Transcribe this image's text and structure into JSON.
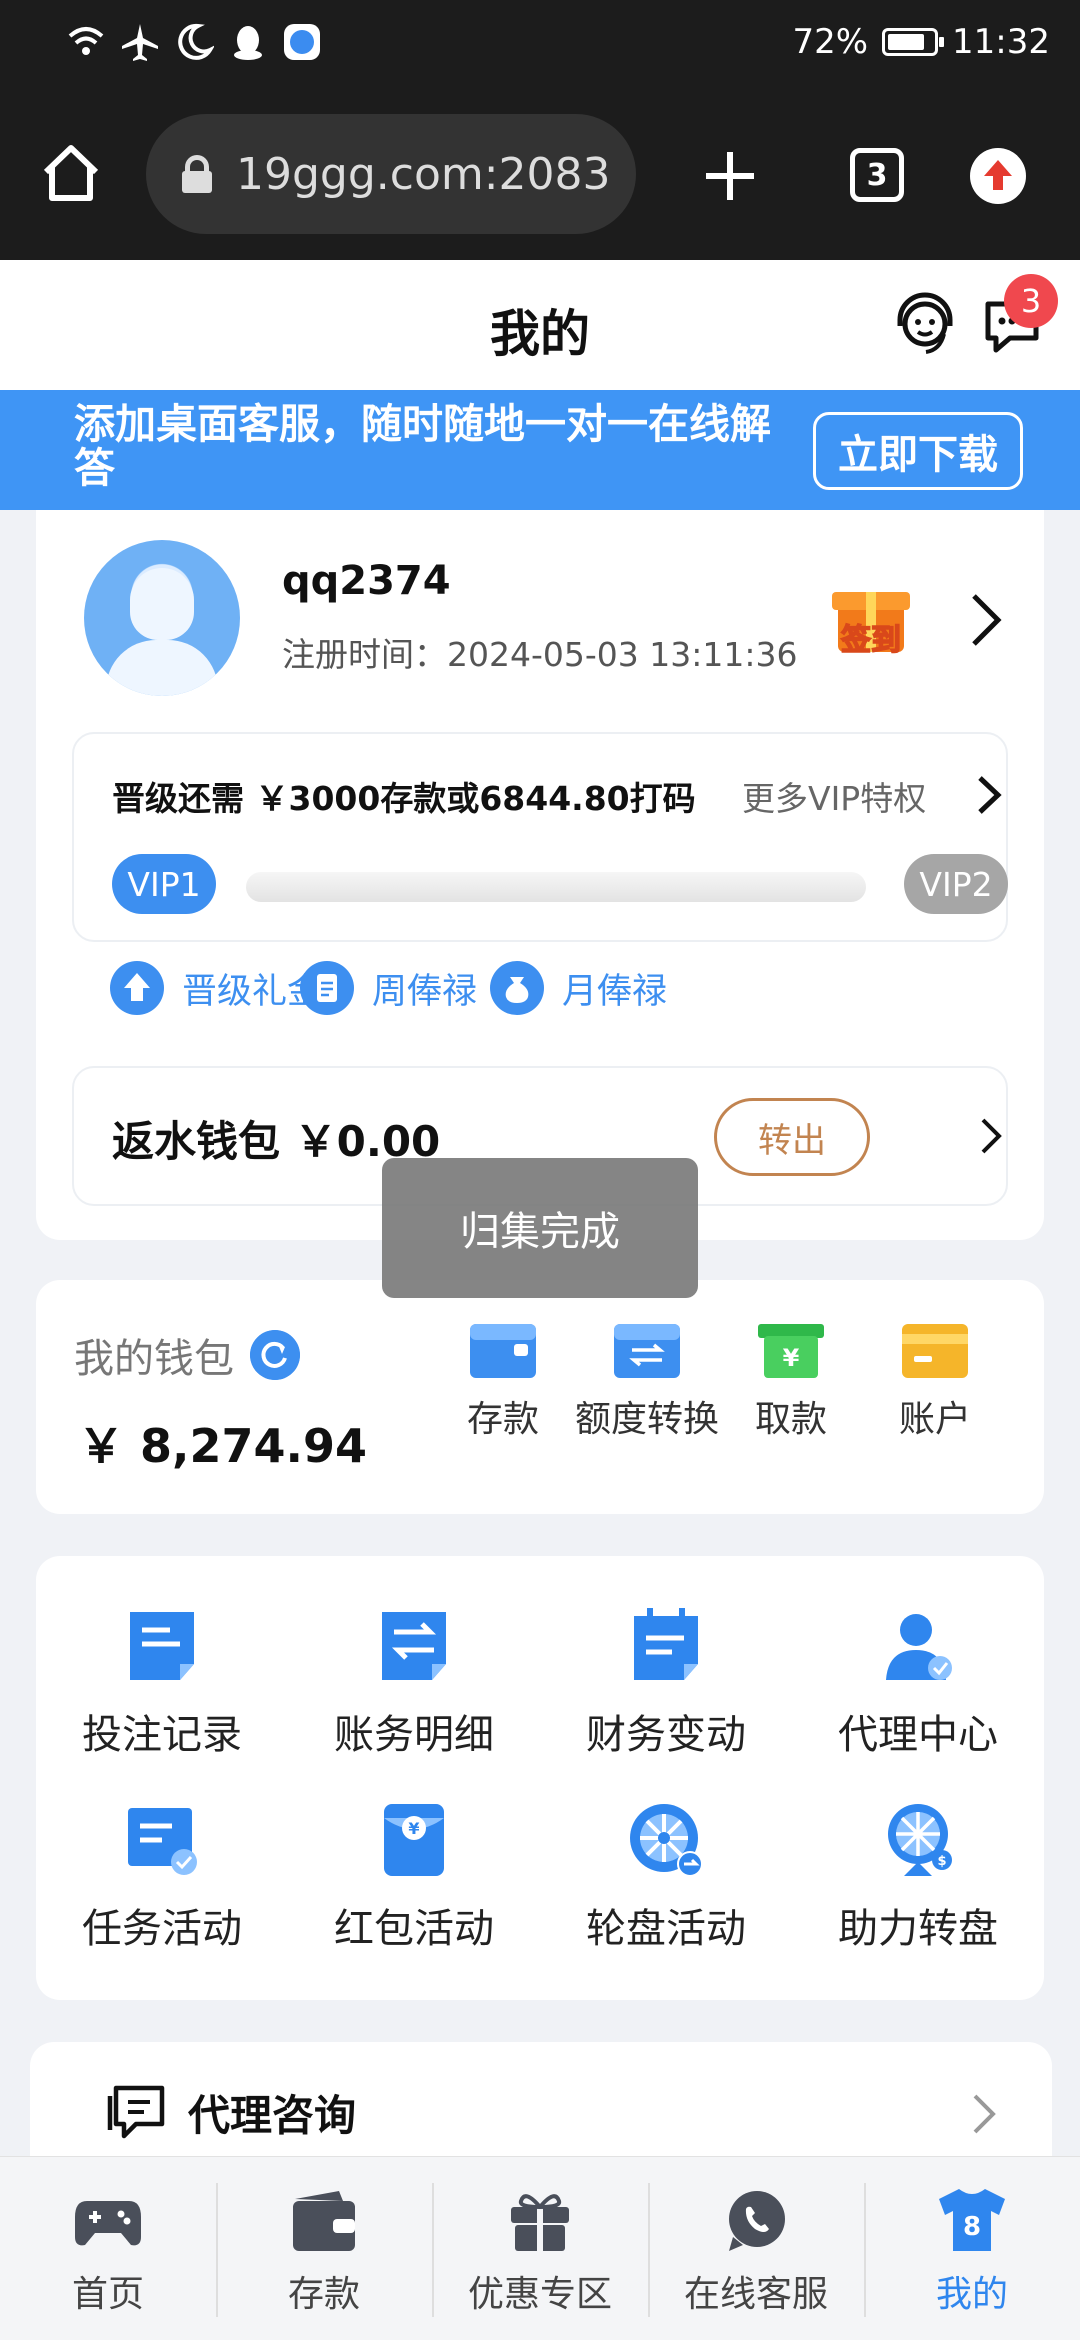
{
  "status_bar": {
    "battery": "72%",
    "time": "11:32"
  },
  "browser": {
    "url": "19ggg.com:2083",
    "tab_count": "3"
  },
  "header": {
    "title": "我的",
    "message_badge": "3"
  },
  "banner": {
    "text": "添加桌面客服，随时随地一对一在线解答",
    "button": "立即下载"
  },
  "profile": {
    "username": "qq2374",
    "register_label": "注册时间：",
    "register_time": "2024-05-03 13:11:36",
    "signin_label": "签到"
  },
  "vip": {
    "need_text": "晋级还需 ￥3000存款或6844.80打码",
    "more_label": "更多VIP特权",
    "current_level": "VIP1",
    "next_level": "VIP2",
    "progress": 0,
    "perks": [
      {
        "label": "晋级礼金",
        "icon": "upgrade-gift-icon"
      },
      {
        "label": "周俸禄",
        "icon": "weekly-salary-icon"
      },
      {
        "label": "月俸禄",
        "icon": "monthly-salary-icon"
      }
    ]
  },
  "rebate": {
    "label": "返水钱包",
    "amount": "￥0.00",
    "button": "转出"
  },
  "toast": {
    "text": "归集完成"
  },
  "wallet": {
    "title": "我的钱包",
    "amount": "￥ 8,274.94",
    "actions": [
      {
        "label": "存款",
        "icon": "deposit-icon",
        "color": "#3d8ff0"
      },
      {
        "label": "额度转换",
        "icon": "transfer-icon",
        "color": "#3d8ff0"
      },
      {
        "label": "取款",
        "icon": "withdraw-icon",
        "color": "#2fb84a"
      },
      {
        "label": "账户",
        "icon": "account-card-icon",
        "color": "#f5b52a"
      }
    ]
  },
  "menu_grid": [
    {
      "label": "投注记录",
      "icon": "bet-record-icon"
    },
    {
      "label": "账务明细",
      "icon": "account-details-icon"
    },
    {
      "label": "财务变动",
      "icon": "finance-change-icon"
    },
    {
      "label": "代理中心",
      "icon": "agent-center-icon"
    },
    {
      "label": "任务活动",
      "icon": "task-activity-icon"
    },
    {
      "label": "红包活动",
      "icon": "red-packet-icon"
    },
    {
      "label": "轮盘活动",
      "icon": "roulette-icon"
    },
    {
      "label": "助力转盘",
      "icon": "lucky-wheel-icon"
    }
  ],
  "agent_consult": {
    "label": "代理咨询"
  },
  "bottom_nav": [
    {
      "label": "首页",
      "icon": "gamepad-icon"
    },
    {
      "label": "存款",
      "icon": "wallet-icon"
    },
    {
      "label": "优惠专区",
      "icon": "gift-icon"
    },
    {
      "label": "在线客服",
      "icon": "whatsapp-chat-icon"
    },
    {
      "label": "我的",
      "icon": "jersey-icon"
    }
  ],
  "colors": {
    "accent": "#3d8ff0",
    "banner": "#3f95f5",
    "badge": "#f0484e",
    "rebate_button": "#c28450"
  }
}
